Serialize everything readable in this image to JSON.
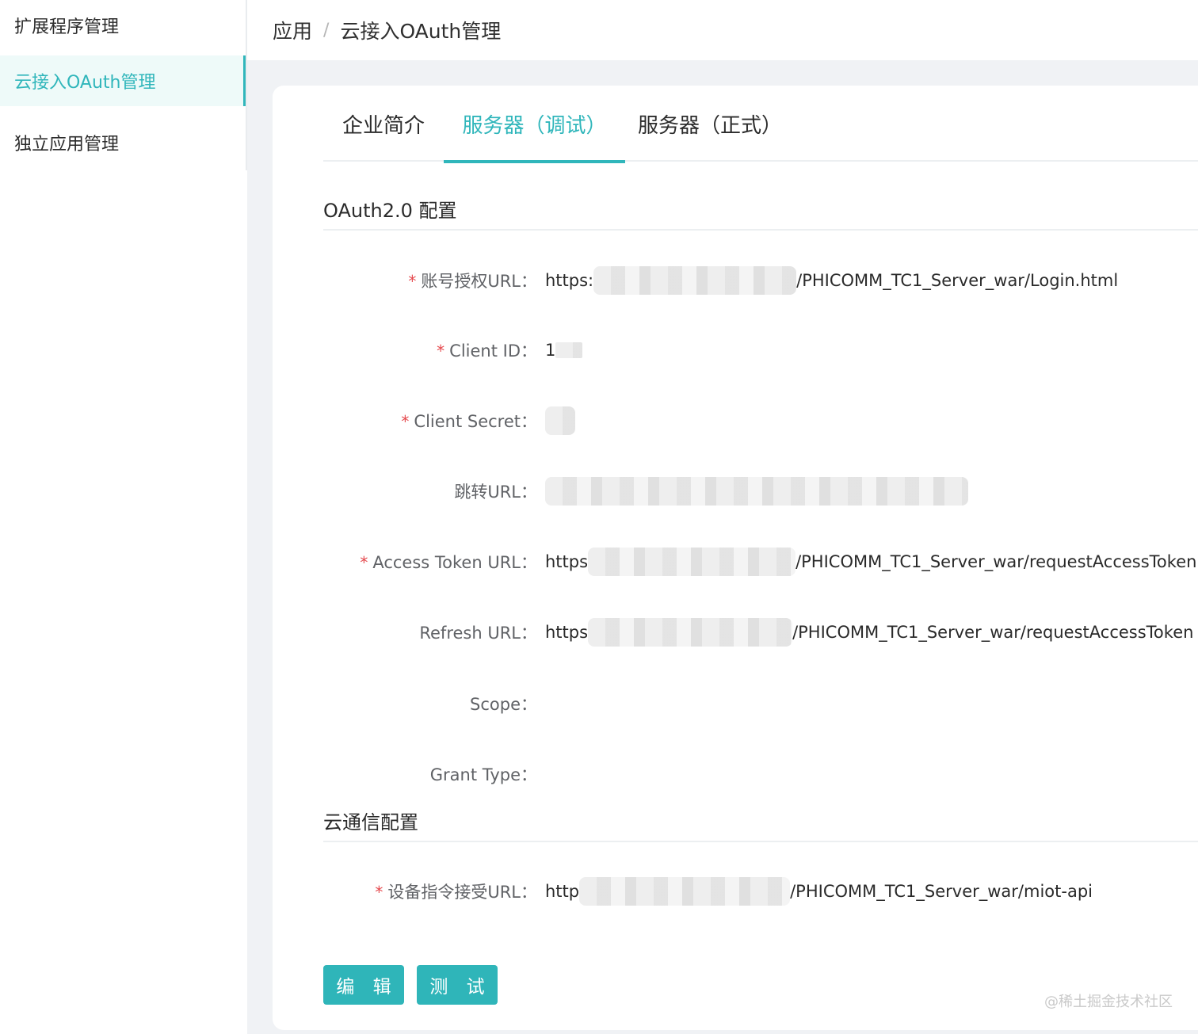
{
  "sidebar": {
    "items": [
      {
        "label": "扩展程序管理",
        "active": false
      },
      {
        "label": "云接入OAuth管理",
        "active": true
      },
      {
        "label": "独立应用管理",
        "active": false
      }
    ]
  },
  "breadcrumb": {
    "root": "应用",
    "separator": "/",
    "current": "云接入OAuth管理"
  },
  "tabs": [
    {
      "label": "企业简介",
      "active": false
    },
    {
      "label": "服务器（调试）",
      "active": true
    },
    {
      "label": "服务器（正式）",
      "active": false
    }
  ],
  "oauth": {
    "title": "OAuth2.0 配置",
    "fields": {
      "auth_url": {
        "label": "账号授权URL",
        "required": true,
        "prefix": "https:",
        "suffix": "/PHICOMM_TC1_Server_war/Login.html"
      },
      "client_id": {
        "label": "Client ID",
        "required": true,
        "prefix": "1"
      },
      "client_secret": {
        "label": "Client Secret",
        "required": true
      },
      "redirect_url": {
        "label": "跳转URL",
        "required": false
      },
      "access_token_url": {
        "label": "Access Token URL",
        "required": true,
        "prefix": "https",
        "suffix": "/PHICOMM_TC1_Server_war/requestAccessToken"
      },
      "refresh_url": {
        "label": "Refresh URL",
        "required": false,
        "prefix": "https",
        "suffix": "/PHICOMM_TC1_Server_war/requestAccessToken"
      },
      "scope": {
        "label": "Scope",
        "required": false,
        "value": ""
      },
      "grant_type": {
        "label": "Grant Type",
        "required": false,
        "value": ""
      }
    }
  },
  "cloud": {
    "title": "云通信配置",
    "fields": {
      "device_url": {
        "label": "设备指令接受URL",
        "required": true,
        "prefix": "http",
        "suffix": "/PHICOMM_TC1_Server_war/miot-api"
      }
    }
  },
  "buttons": {
    "edit": "编 辑",
    "test": "测 试"
  },
  "watermark": "@稀土掘金技术社区",
  "required_mark": "*",
  "colon": "：",
  "colors": {
    "accent": "#30b6bb",
    "button": "#2fb5b9",
    "required": "#e5484d"
  }
}
